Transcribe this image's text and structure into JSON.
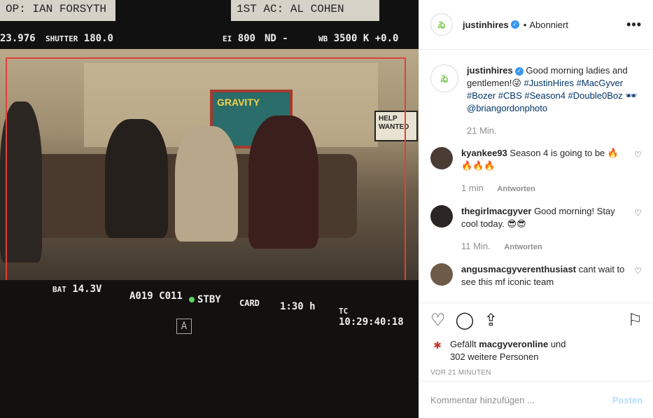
{
  "photo": {
    "slate_left": "OP: IAN FORSYTH",
    "slate_right": "1ST AC: AL COHEN",
    "fps": "23.976",
    "shutter_label": "SHUTTER",
    "shutter_value": "180.0",
    "ei_label": "EI",
    "ei_value": "800",
    "nd_label": "ND",
    "nd_value": "-",
    "wb_label": "WB",
    "wb_value": "3500 K",
    "tint_value": "+0.0",
    "poster_text": "GRAVITY",
    "sign_text": "HELP WANTED",
    "bat_label": "BAT",
    "bat_value": "14.3V",
    "clip_id": "A019 C011",
    "stby": "STBY",
    "card_label": "CARD",
    "card_time": "1:30 h",
    "tc_label": "TC",
    "tc_value": "10:29:40:18",
    "cam_letter": "A"
  },
  "header": {
    "username": "justinhires",
    "separator": "•",
    "follow_label": "Abonniert",
    "more_label": "•••"
  },
  "caption": {
    "username": "justinhires",
    "text": "Good morning ladies and gentlemen!😜",
    "tags": "#JustinHires #MacGyver #Bozer #CBS #Season4 #Double0Boz 🕶 @briangordonphoto",
    "time": "21 Min."
  },
  "comments": [
    {
      "username": "kyankee93",
      "text": "Season 4 is going to be 🔥🔥🔥🔥",
      "time": "1 min",
      "reply": "Antworten"
    },
    {
      "username": "thegirlmacgyver",
      "text": "Good morning! Stay cool today. 😎😎",
      "time": "11 Min.",
      "reply": "Antworten"
    },
    {
      "username": "angusmacgyverenthusiast",
      "text": "cant wait to see this mf iconic team",
      "time": "",
      "reply": ""
    }
  ],
  "likes": {
    "first_user": "macgyveronline",
    "prefix": "Gefällt",
    "conj": "und",
    "rest": "302 weitere Personen"
  },
  "posted_ago": "VOR 21 MINUTEN",
  "composer": {
    "placeholder": "Kommentar hinzufügen ...",
    "post_label": "Posten"
  },
  "colors": {
    "link": "#003569",
    "verified": "#3897f0",
    "muted": "#8e8e8e",
    "post_disabled": "#b2dffc",
    "frame_red": "#e0413a"
  }
}
